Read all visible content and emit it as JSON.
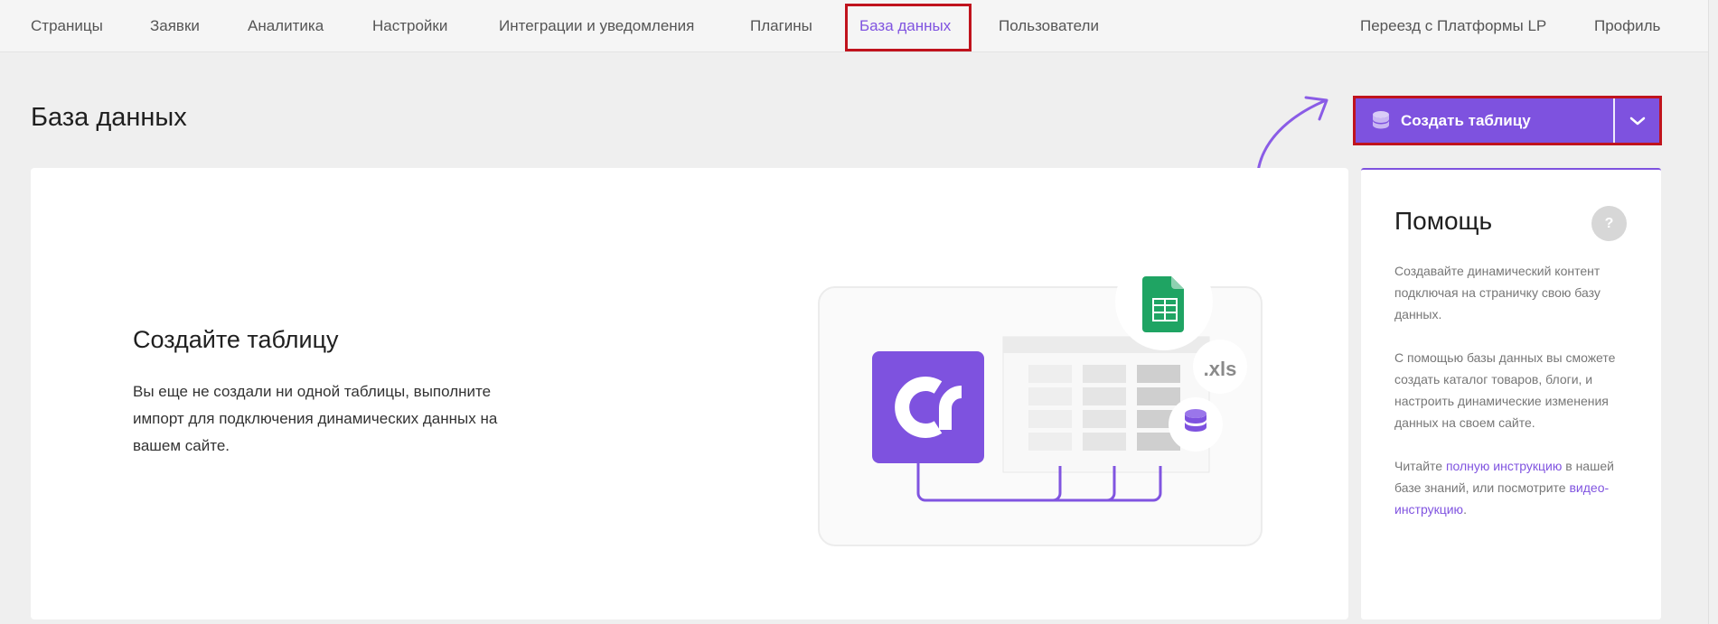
{
  "nav": {
    "items": [
      {
        "label": "Страницы"
      },
      {
        "label": "Заявки"
      },
      {
        "label": "Аналитика"
      },
      {
        "label": "Настройки"
      },
      {
        "label": "Интеграции и уведомления"
      },
      {
        "label": "Плагины"
      },
      {
        "label": "База данных"
      },
      {
        "label": "Пользователи"
      }
    ],
    "right": [
      {
        "label": "Переезд с Платформы LP"
      },
      {
        "label": "Профиль"
      }
    ],
    "active": "База данных"
  },
  "header": {
    "title": "База данных",
    "create_button": "Создать таблицу"
  },
  "empty": {
    "title": "Создайте таблицу",
    "text": "Вы еще не создали ни одной таблицы, выполните импорт для подключения динамических данных на вашем сайте.",
    "xls_label": ".xls"
  },
  "help": {
    "title": "Помощь",
    "q": "?",
    "p1": "Создавайте динамический контент подключая на страничку свою базу данных.",
    "p2": "С помощью базы данных вы сможете создать каталог товаров, блоги, и настроить динамические изменения данных на своем сайте.",
    "p3_before": "Читайте",
    "p3_link1": "полную инструкцию",
    "p3_mid": "в нашей базе знаний, или посмотрите",
    "p3_link2": "видео-инструкцию",
    "p3_end": "."
  },
  "colors": {
    "accent": "#7e52df",
    "highlight": "#c0131d",
    "sheets_green": "#1fa463"
  },
  "icons": [
    "database-icon",
    "chevron-down-icon",
    "curved-arrow-icon",
    "google-sheets-icon",
    "platform-logo-icon"
  ]
}
